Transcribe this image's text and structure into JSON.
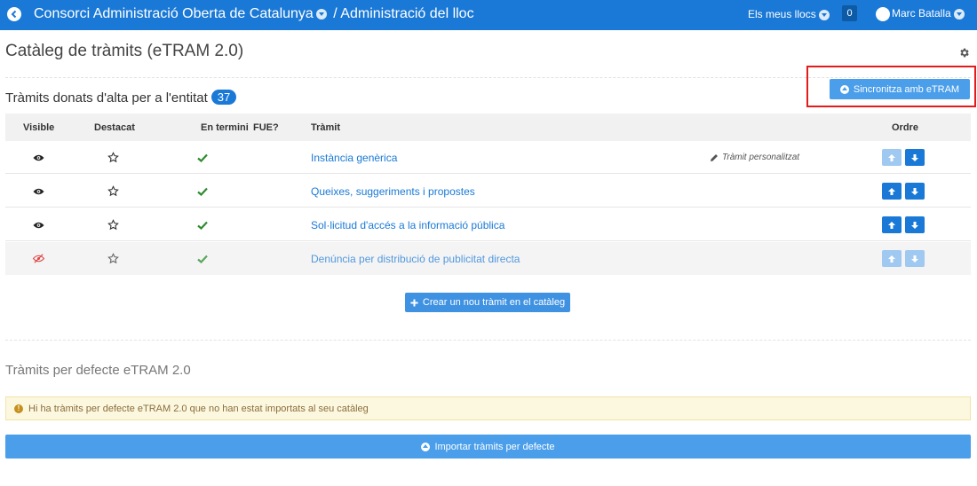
{
  "header": {
    "title": "Consorci Administració Oberta de Catalunya",
    "subtitle": "/ Administració del lloc",
    "sites_label": "Els meus llocs",
    "notifications_count": "0",
    "user_name": "Marc Batalla"
  },
  "page": {
    "title": "Catàleg de tràmits (eTRAM 2.0)",
    "section_title": "Tràmits donats d'alta per a l'entitat",
    "section_count": "37",
    "sync_button": "Sincronitza amb eTRAM",
    "create_button": "Crear un nou tràmit en el catàleg",
    "defaults_title": "Tràmits per defecte eTRAM 2.0",
    "alert_text": "Hi ha tràmits per defecte eTRAM 2.0 que no han estat importats al seu catàleg",
    "import_button": "Importar tràmits per defecte"
  },
  "table": {
    "columns": {
      "visible": "Visible",
      "featured": "Destacat",
      "in_term": "En termini",
      "fue": "FUE?",
      "procedure": "Tràmit",
      "order": "Ordre"
    },
    "rows": [
      {
        "name": "Instància genèrica",
        "visible": true,
        "custom": "Tràmit personalitzat",
        "up_enabled": false,
        "down_enabled": true
      },
      {
        "name": "Queixes, suggeriments i propostes",
        "visible": true,
        "custom": "",
        "up_enabled": true,
        "down_enabled": true
      },
      {
        "name": "Sol·licitud d'accés a la informació pública",
        "visible": true,
        "custom": "",
        "up_enabled": true,
        "down_enabled": true
      },
      {
        "name": "Denúncia per distribució de publicitat directa",
        "visible": false,
        "custom": "",
        "up_enabled": false,
        "down_enabled": false
      }
    ]
  },
  "colors": {
    "primary": "#1a79d6",
    "button": "#4a9eea",
    "check": "#2e8b2e",
    "hidden_eye": "#e04545",
    "highlight": "#e31b1b",
    "alert_bg": "#fcf8e0"
  }
}
